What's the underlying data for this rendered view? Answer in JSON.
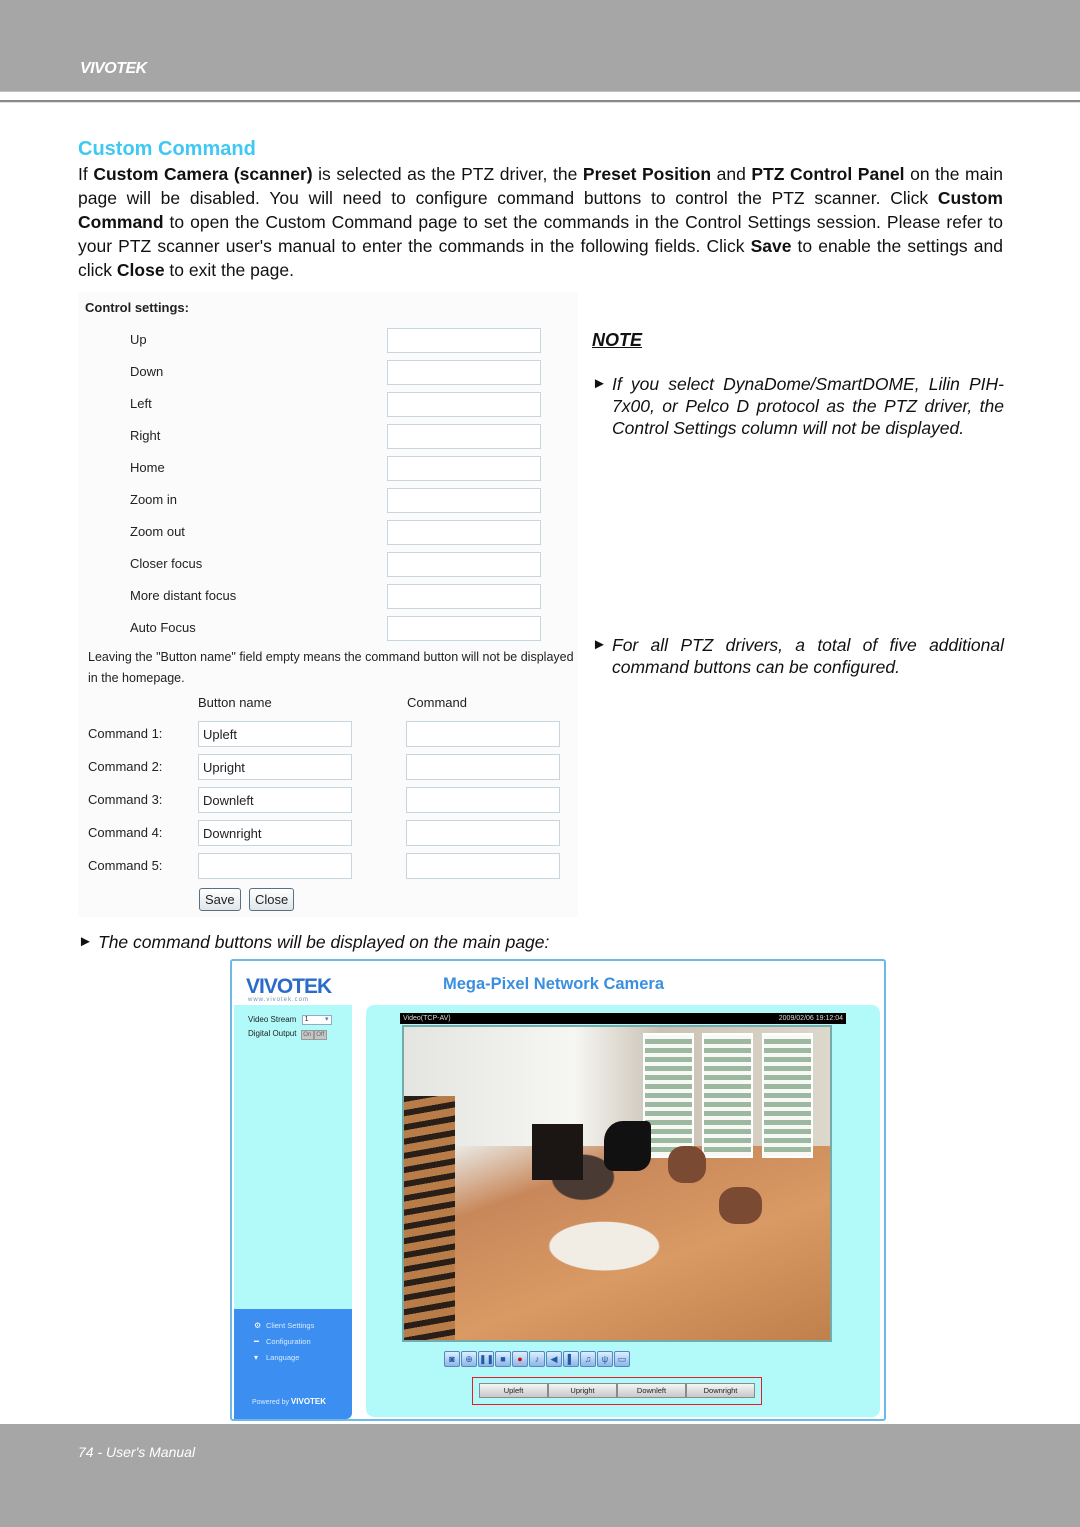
{
  "header": {
    "brand": "VIVOTEK"
  },
  "section": {
    "title": "Custom Command",
    "intro": [
      {
        "t": "If ",
        "b": false
      },
      {
        "t": "Custom Camera (scanner)",
        "b": true
      },
      {
        "t": " is selected as the PTZ driver, the ",
        "b": false
      },
      {
        "t": "Preset Position",
        "b": true
      },
      {
        "t": " and ",
        "b": false
      },
      {
        "t": "PTZ Control Panel",
        "b": true
      },
      {
        "t": " on the main page will be disabled. You will need to configure command buttons to control the PTZ scanner. Click ",
        "b": false
      },
      {
        "t": "Custom Command",
        "b": true
      },
      {
        "t": " to open the Custom Command page to set the commands in the Control Settings session. Please refer to your PTZ scanner user's manual to enter the commands in the following fields. Click ",
        "b": false
      },
      {
        "t": "Save",
        "b": true
      },
      {
        "t": " to enable the settings and click ",
        "b": false
      },
      {
        "t": "Close",
        "b": true
      },
      {
        "t": " to exit the page.",
        "b": false
      }
    ]
  },
  "form": {
    "control_settings_title": "Control settings:",
    "control_settings": [
      {
        "label": "Up",
        "value": ""
      },
      {
        "label": "Down",
        "value": ""
      },
      {
        "label": "Left",
        "value": ""
      },
      {
        "label": "Right",
        "value": ""
      },
      {
        "label": "Home",
        "value": ""
      },
      {
        "label": "Zoom in",
        "value": ""
      },
      {
        "label": "Zoom out",
        "value": ""
      },
      {
        "label": "Closer focus",
        "value": ""
      },
      {
        "label": "More distant focus",
        "value": ""
      },
      {
        "label": "Auto Focus",
        "value": ""
      }
    ],
    "hint": "Leaving the \"Button name\" field empty means the command button will not be displayed in the homepage.",
    "col_button_name": "Button name",
    "col_command": "Command",
    "commands": [
      {
        "label": "Command 1:",
        "button_name": "Upleft",
        "command": ""
      },
      {
        "label": "Command 2:",
        "button_name": "Upright",
        "command": ""
      },
      {
        "label": "Command 3:",
        "button_name": "Downleft",
        "command": ""
      },
      {
        "label": "Command 4:",
        "button_name": "Downright",
        "command": ""
      },
      {
        "label": "Command 5:",
        "button_name": "",
        "command": ""
      }
    ],
    "save_label": "Save",
    "close_label": "Close"
  },
  "note": {
    "title": "NOTE",
    "arrow": "►",
    "items": [
      "If you select DynaDome/SmartDOME, Lilin PIH-7x00, or Pelco D protocol as the PTZ driver, the Control Settings column will not be displayed.",
      "For all PTZ drivers, a total of five additional command buttons can be configured."
    ]
  },
  "caption": "The command buttons will be displayed on the main page:",
  "camera_page": {
    "logo": "VIVOTEK",
    "logo_sub": "www.vivotek.com",
    "title": "Mega-Pixel Network Camera",
    "video_stream_label": "Video Stream",
    "video_stream_value": "1",
    "digital_output_label": "Digital Output",
    "digital_output_on": "On",
    "digital_output_off": "Off",
    "video_label": "Video(TCP-AV)",
    "timestamp": "2009/02/06 19:12:04",
    "nav": [
      {
        "icon": "gear-icon",
        "glyph": "⚙",
        "label": "Client Settings"
      },
      {
        "icon": "wrench-icon",
        "glyph": "━",
        "label": "Configuration"
      },
      {
        "icon": "language-icon",
        "glyph": "▾",
        "label": "Language"
      }
    ],
    "powered_by": "Powered by",
    "powered_brand": "VIVOTEK",
    "toolbar": [
      {
        "name": "snapshot-icon",
        "glyph": "◙"
      },
      {
        "name": "digital-zoom-icon",
        "glyph": "⊕"
      },
      {
        "name": "pause-icon",
        "glyph": "❚❚"
      },
      {
        "name": "stop-icon",
        "glyph": "■"
      },
      {
        "name": "record-icon",
        "glyph": "●"
      },
      {
        "name": "volume-icon",
        "glyph": "♪"
      },
      {
        "name": "mute-icon",
        "glyph": "◀"
      },
      {
        "name": "talk-icon",
        "glyph": "▌"
      },
      {
        "name": "mic-icon",
        "glyph": "♫"
      },
      {
        "name": "manual-trigger-icon",
        "glyph": "ψ"
      },
      {
        "name": "fullscreen-icon",
        "glyph": "▭"
      }
    ],
    "custom_buttons": [
      "Upleft",
      "Upright",
      "Downleft",
      "Downright"
    ]
  },
  "footer": {
    "page_label": "74 - User's Manual"
  },
  "colors": {
    "heading": "#3fc9f2",
    "band": "#a6a6a6",
    "panel": "#b2fafa",
    "nav": "#3c8ef0",
    "highlight": "#e01e2a"
  }
}
